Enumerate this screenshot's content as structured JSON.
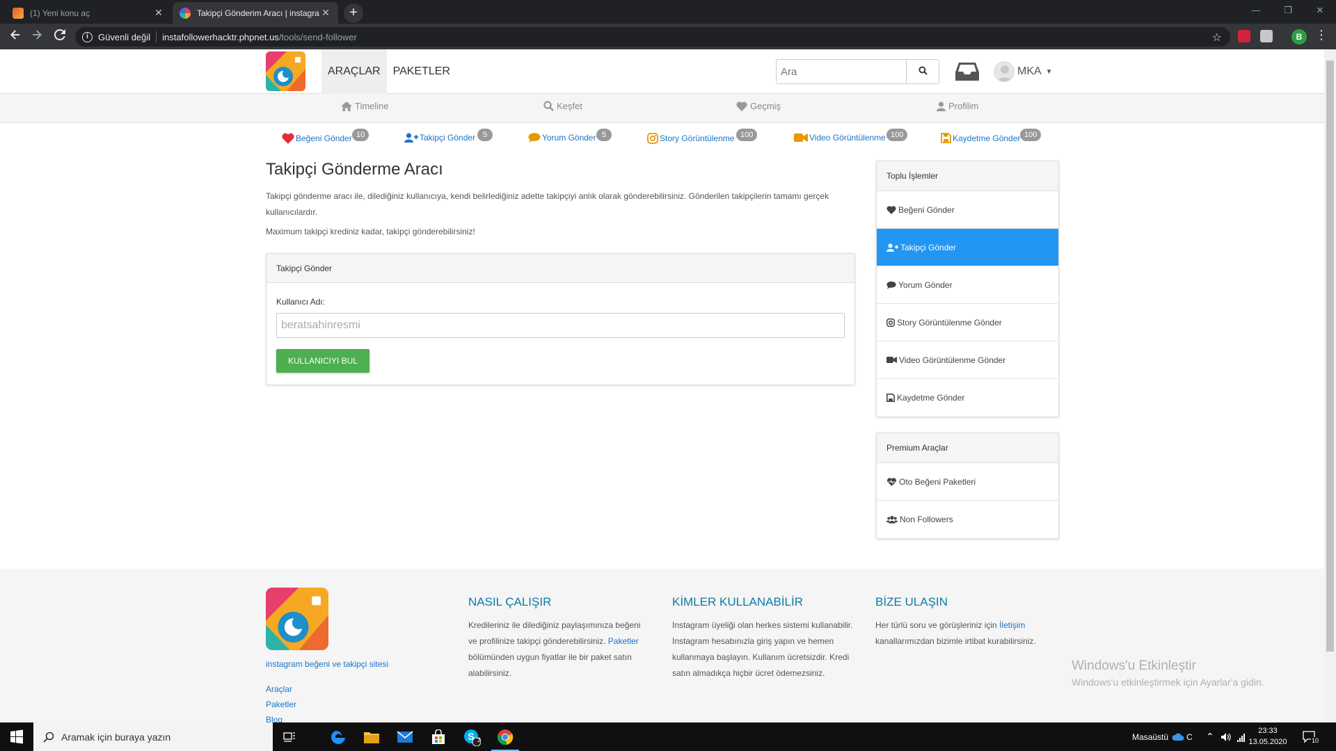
{
  "browser": {
    "tabs": [
      {
        "title": "(1) Yeni konu aç",
        "active": false
      },
      {
        "title": "Takipçi Gönderim Aracı | instagra",
        "active": true
      }
    ],
    "new_tab": "+",
    "window_controls": {
      "minimize": "—",
      "restore": "❐",
      "close": "✕"
    },
    "security_label": "Güvenli değil",
    "url_host": "instafollowerhacktr.phpnet.us",
    "url_path": "/tools/send-follower",
    "profile_initial": "B"
  },
  "header": {
    "nav": [
      "ARAÇLAR",
      "PAKETLER"
    ],
    "search_placeholder": "Ara",
    "username": "MKA"
  },
  "subnav": [
    "Timeline",
    "Keşfet",
    "Geçmiş",
    "Profilim"
  ],
  "tools": [
    {
      "label": "Beğeni Gönder",
      "count": "10",
      "icon": "heart-icon"
    },
    {
      "label": "Takipçi Gönder",
      "count": "5",
      "icon": "user-plus-icon"
    },
    {
      "label": "Yorum Gönder",
      "count": "5",
      "icon": "comment-icon"
    },
    {
      "label": "Story Görüntülenme",
      "count": "100",
      "icon": "instagram-icon"
    },
    {
      "label": "Video Görüntülenme",
      "count": "100",
      "icon": "video-camera-icon"
    },
    {
      "label": "Kaydetme Gönder",
      "count": "100",
      "icon": "floppy-disk-icon"
    }
  ],
  "main": {
    "title": "Takipçi Gönderme Aracı",
    "description": "Takipçi gönderme aracı ile, dilediğiniz kullanıcıya, kendi belirlediğiniz adette takipçiyi anlık olarak gönderebilirsiniz. Gönderilen takipçilerin tamamı gerçek kullanıcılardır.",
    "note": "Maximum takipçi krediniz kadar, takipçi gönderebilirsiniz!",
    "panel": {
      "title": "Takipçi Gönder",
      "field_label": "Kullanıcı Adı:",
      "field_value": "beratsahinresmi",
      "button": "KULLANICIYI BUL"
    }
  },
  "sidebar": {
    "bulk": {
      "title": "Toplu İşlemler",
      "items": [
        "Beğeni Gönder",
        "Takipçi Gönder",
        "Yorum Gönder",
        "Story Görüntülenme Gönder",
        "Video Görüntülenme Gönder",
        "Kaydetme Gönder"
      ],
      "active_index": 1
    },
    "premium": {
      "title": "Premium Araçlar",
      "items": [
        "Oto Beğeni Paketleri",
        "Non Followers"
      ]
    }
  },
  "footer": {
    "tagline": "instagram beğeni ve takipçi sitesi",
    "links": [
      "Araçlar",
      "Paketler",
      "Blog"
    ],
    "how": {
      "title": "NASIL ÇALIŞIR",
      "text1": "Kredileriniz ile dilediğiniz paylaşımınıza beğeni ve profilinize takipçi gönderebilirsiniz.",
      "link": "Paketler",
      "text2": "bölümünden uygun fiyatlar ile bir paket satın alabilirsiniz."
    },
    "who": {
      "title": "KİMLER KULLANABİLİR",
      "text": "Instagram üyeliği olan herkes sistemi kullanabilir. Instagram hesabınızla giriş yapın ve hemen kullanmaya başlayın. Kullanım ücretsizdir. Kredi satın almadıkça hiçbir ücret ödemezsiniz."
    },
    "contact": {
      "title": "BİZE ULAŞIN",
      "text1": "Her türlü soru ve görüşleriniz için",
      "link": "İletişim",
      "text2": "kanallarımızdan bizimle irtibat kurabilirsiniz."
    }
  },
  "watermark": {
    "line1": "Windows'u Etkinleştir",
    "line2": "Windows'u etkinleştirmek için Ayarlar'a gidin."
  },
  "taskbar": {
    "search_placeholder": "Aramak için buraya yazın",
    "skype_badge": "3",
    "desktop_label": "Masaüstü",
    "weather": "C",
    "time": "23:33",
    "date": "13.05.2020",
    "notifications": "10"
  }
}
